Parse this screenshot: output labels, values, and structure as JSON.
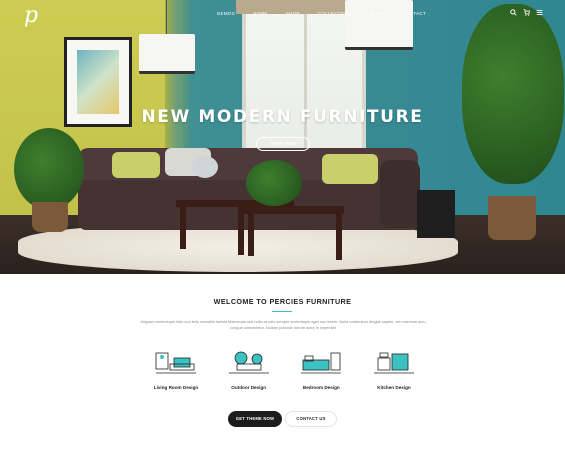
{
  "header": {
    "logo_text": "p",
    "nav": [
      "Demos",
      "Home",
      "Shop",
      "Collections",
      "Blog",
      "Contact"
    ],
    "cart_count": "0",
    "icons": [
      "search-icon",
      "cart-icon",
      "menu-icon"
    ]
  },
  "hero": {
    "title": "NEW MODERN FURNITURE",
    "button": "SHOP NOW"
  },
  "welcome": {
    "title": "WELCOME TO PERCIES FURNITURE",
    "description": "Aliquam scelerisque felis non felis convallis lacinia Maecenas sed nulla at odio semper scelerisque eget non lorem. Nulla vestibulum feugiat sapien, vel maximus arcu congue consectetur. Nullam pulvinar rutrum dolor in imperdiet"
  },
  "categories": [
    {
      "label": "Living Room Design",
      "icon": "living-room-icon"
    },
    {
      "label": "Outdoor Design",
      "icon": "outdoor-icon"
    },
    {
      "label": "Bedroom Design",
      "icon": "bedroom-icon"
    },
    {
      "label": "Kitchen Design",
      "icon": "kitchen-icon"
    }
  ],
  "cta": {
    "primary": "GET THEME NOW",
    "secondary": "CONTACT US"
  },
  "colors": {
    "accent": "#3cc2c0",
    "dark": "#1c1c1c"
  }
}
